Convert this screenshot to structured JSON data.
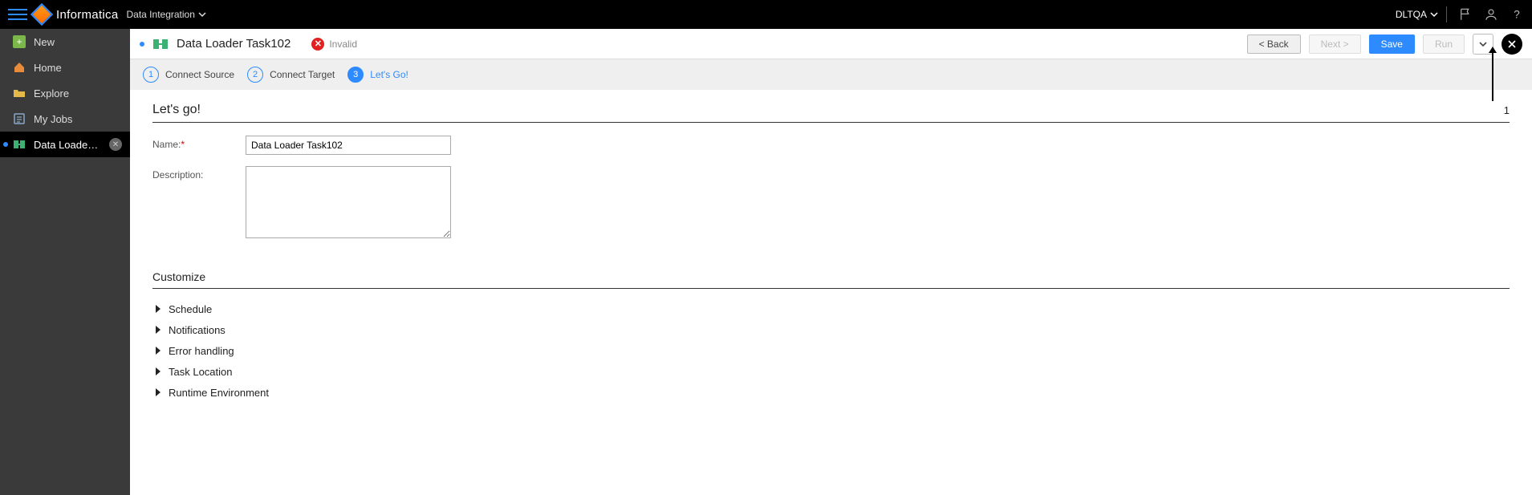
{
  "header": {
    "brand": "Informatica",
    "app_name": "Data Integration",
    "org": "DLTQA"
  },
  "sidebar": {
    "items": [
      {
        "key": "new",
        "label": "New"
      },
      {
        "key": "home",
        "label": "Home"
      },
      {
        "key": "explore",
        "label": "Explore"
      },
      {
        "key": "myjobs",
        "label": "My Jobs"
      },
      {
        "key": "task",
        "label": "Data Loader Task1...",
        "active": true,
        "closable": true,
        "dirty": true
      }
    ]
  },
  "mainhead": {
    "title": "Data Loader Task102",
    "status": "Invalid",
    "back": "< Back",
    "next": "Next >",
    "save": "Save",
    "run": "Run"
  },
  "wizard": {
    "steps": [
      {
        "num": "1",
        "label": "Connect Source"
      },
      {
        "num": "2",
        "label": "Connect Target"
      },
      {
        "num": "3",
        "label": "Let's Go!",
        "active": true
      }
    ]
  },
  "form": {
    "section_title": "Let's go!",
    "issue_count": "1",
    "name_label": "Name:",
    "name_value": "Data Loader Task102",
    "desc_label": "Description:",
    "desc_value": ""
  },
  "customize": {
    "title": "Customize",
    "items": [
      "Schedule",
      "Notifications",
      "Error handling",
      "Task Location",
      "Runtime Environment"
    ]
  }
}
